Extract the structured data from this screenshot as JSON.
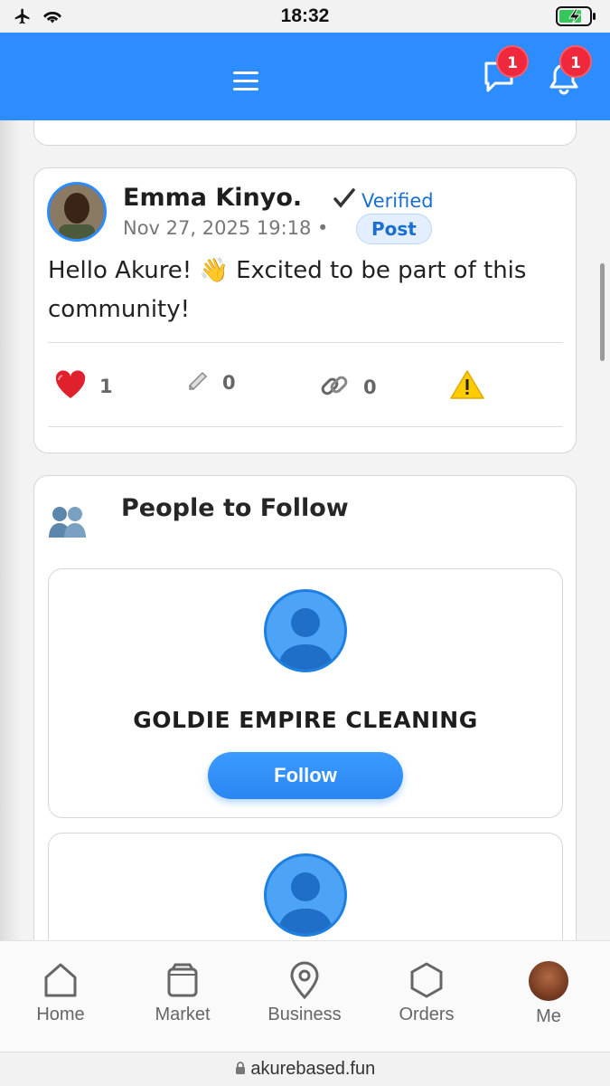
{
  "status_bar": {
    "time": "18:32"
  },
  "header": {
    "messages_badge": "1",
    "notifications_badge": "1",
    "brand_color": "#2d8cff"
  },
  "post": {
    "author": "Emma Kinyo.",
    "verified_label": "Verified",
    "date": "Nov 27, 2025 19:18 •",
    "type_chip": "Post",
    "text": "Hello Akure! 👋 Excited to be part of this community!",
    "likes": "1",
    "comments": "0",
    "shares": "0"
  },
  "people_to_follow": {
    "title": "People to Follow",
    "items": [
      {
        "name": "GOLDIE EMPIRE CLEANING",
        "button": "Follow"
      }
    ]
  },
  "bottom_nav": [
    {
      "label": "Home",
      "icon": "home-icon"
    },
    {
      "label": "Market",
      "icon": "market-icon"
    },
    {
      "label": "Business",
      "icon": "location-pin-icon"
    },
    {
      "label": "Orders",
      "icon": "hexagon-icon"
    },
    {
      "label": "Me",
      "icon": "avatar"
    }
  ],
  "browser": {
    "url": "akurebased.fun"
  }
}
